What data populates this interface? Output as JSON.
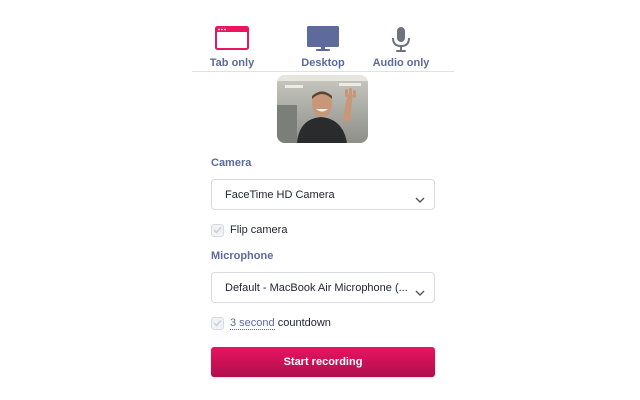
{
  "source_tabs": [
    {
      "label": "Tab only",
      "icon": "browser-tab-icon",
      "color": "#e8155f"
    },
    {
      "label": "Desktop",
      "icon": "desktop-monitor-icon",
      "color": "#5c6a9c"
    },
    {
      "label": "Audio only",
      "icon": "microphone-icon",
      "color": "#6f7280"
    }
  ],
  "camera": {
    "label": "Camera",
    "value": "FaceTime HD Camera",
    "flip_label": "Flip camera"
  },
  "microphone": {
    "label": "Microphone",
    "value": "Default - MacBook Air Microphone (..."
  },
  "countdown": {
    "duration": "3 second",
    "suffix": " countdown"
  },
  "record_button": "Start recording",
  "colors": {
    "accent": "#e8155f",
    "accent_dark": "#b00d4e",
    "label": "#5c6a9c",
    "border": "#d8dae3"
  }
}
